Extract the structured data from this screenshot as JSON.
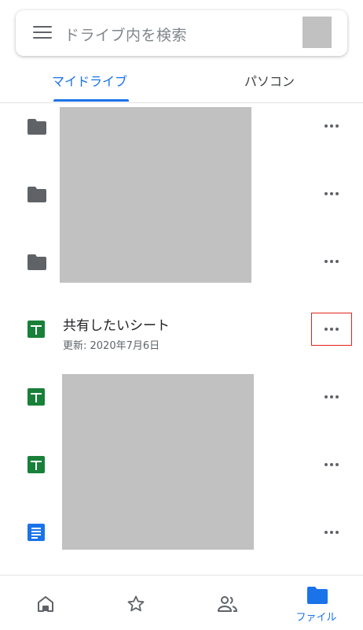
{
  "search": {
    "placeholder": "ドライブ内を検索",
    "menu_icon": "hamburger-menu-icon",
    "avatar": "account-avatar"
  },
  "tabs": [
    {
      "label": "マイドライブ",
      "active": true
    },
    {
      "label": "パソコン",
      "active": false
    }
  ],
  "files": [
    {
      "type": "folder",
      "icon": "folder-icon"
    },
    {
      "type": "folder",
      "icon": "folder-icon"
    },
    {
      "type": "folder",
      "icon": "folder-icon"
    },
    {
      "type": "sheet",
      "icon": "sheets-icon",
      "name": "共有したいシート",
      "meta": "更新: 2020年7月6日",
      "highlighted": true
    },
    {
      "type": "sheet",
      "icon": "sheets-icon"
    },
    {
      "type": "sheet",
      "icon": "sheets-icon"
    },
    {
      "type": "doc",
      "icon": "docs-icon"
    }
  ],
  "bottom_nav": [
    {
      "icon": "home-icon",
      "label": ""
    },
    {
      "icon": "star-icon",
      "label": ""
    },
    {
      "icon": "shared-people-icon",
      "label": ""
    },
    {
      "icon": "folder-icon",
      "label": "ファイル",
      "active": true
    }
  ],
  "colors": {
    "accent": "#1a73e8",
    "sheets_green": "#188038",
    "highlight_red": "#e2231a",
    "redaction_gray": "#c1c1c1"
  }
}
